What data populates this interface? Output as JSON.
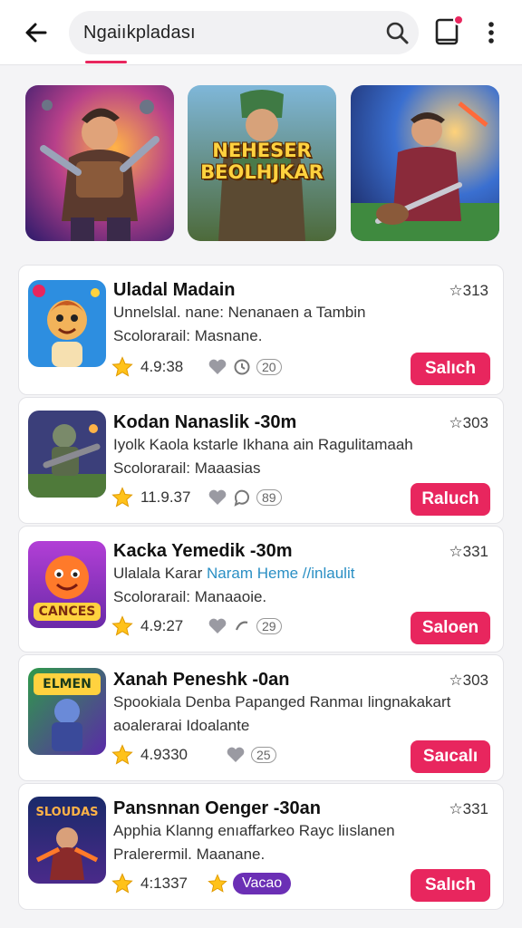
{
  "header": {
    "search_value": "Ngaiıkpladası",
    "icons": {
      "back": "arrow-left-icon",
      "search": "search-icon",
      "doc": "document-icon",
      "more": "more-vertical-icon"
    },
    "accent": "#e8265e"
  },
  "banners": [
    {
      "name": "banner-warrior",
      "title": ""
    },
    {
      "name": "banner-title-art",
      "title": "NEHESER BEOLHJKAR"
    },
    {
      "name": "banner-guitar",
      "title": ""
    }
  ],
  "apps": [
    {
      "name": "Uladal Madain",
      "rank": "☆313",
      "desc": "Unnelslal. nane: Nenanaen a Tambin",
      "desc_link": "",
      "sub": "Scolorarail: Masnane.",
      "rating": "4.9:38",
      "meta": "20",
      "tag": "",
      "action": "Salıch"
    },
    {
      "name": "Kodan Nanaslik -30m",
      "rank": "☆303",
      "desc": "Iyolk Kaola kstarle Ikhana ain Ragulitamaah",
      "desc_link": "",
      "sub": "Scolorarail: Maaasias",
      "rating": "11.9.37",
      "meta": "89",
      "tag": "",
      "action": "Raluch"
    },
    {
      "name": "Kacka Yemedik -30m",
      "rank": "☆331",
      "desc": "Ulalala Karar ",
      "desc_link": "Naram Heme //inlaulit",
      "sub": "Scolorarail: Manaaoie.",
      "rating": "4.9:27",
      "meta": "29",
      "tag": "",
      "action": "Saloen"
    },
    {
      "name": "Xanah Peneshk -0an",
      "rank": "☆303",
      "desc": "Spookiala Denba Papanged Ranmaı lingnakakart",
      "desc_link": "",
      "sub": "aoalerarai Idoalante",
      "rating": "4.9330",
      "meta": "25",
      "tag": "",
      "action": "Saıcalı"
    },
    {
      "name": "Pansnnan Oenger -30an",
      "rank": "☆331",
      "desc": "Apphia Klanng enıaffarkeo Rayc liıslanen",
      "desc_link": "",
      "sub": "Pralerermil. Maanane.",
      "rating": "4:1337",
      "meta": "",
      "tag": "Vacao",
      "action": "Salıch"
    }
  ],
  "icon_labels": {
    "star": "CANCES",
    "icon4": "ELMEN",
    "icon5": "SLOUDAS"
  }
}
